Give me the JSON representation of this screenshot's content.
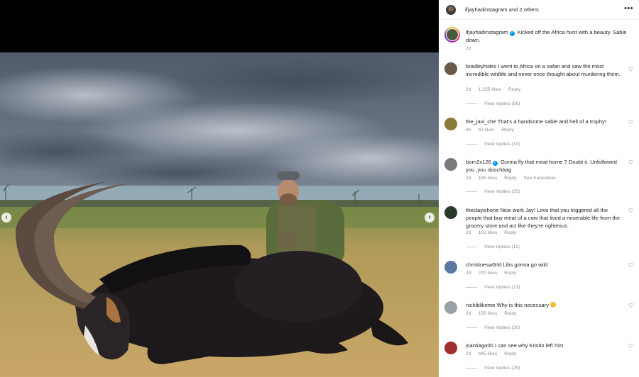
{
  "post": {
    "header_name": "ifjayhadinstagram and 2 others",
    "author": "ifjayhadinstagram",
    "caption": "Kicked off the Africa hunt with a beauty. Sable down.",
    "time": "2d"
  },
  "comments": [
    {
      "user": "bradleyhides",
      "text": "I went to Africa on a safari and saw the most incredible wildlife and never once thought about murdering them.",
      "time": "2d",
      "likes": "1,255 likes",
      "reply": "Reply",
      "replies": "View replies (56)",
      "avatar_color": "#6b5a4a"
    },
    {
      "user": "the_javi_che",
      "text": "That's a handsome sable and hell of a trophy!",
      "time": "8h",
      "likes": "43 likes",
      "reply": "Reply",
      "replies": "View replies (10)",
      "avatar_color": "#8a7a3a"
    },
    {
      "user": "born2x126",
      "text": "Gonna fly that meat home ? Doubt it. Unfollowed you ,you doochbag",
      "time": "2d",
      "likes": "155 likes",
      "reply": "Reply",
      "extra": "See translation",
      "replies": "View replies (25)",
      "avatar_color": "#7a7a7a"
    },
    {
      "user": "theclayishone",
      "text": "Nice work Jay! Love that you triggered all the people that buy meat of a cow that lived a miserable life from the grocery store and act like they're righteous.",
      "time": "2d",
      "likes": "103 likes",
      "reply": "Reply",
      "replies": "View replies (11)",
      "avatar_color": "#2a3a2a"
    },
    {
      "user": "christinesw0rld",
      "text": "Libs gonna go wild",
      "time": "2d",
      "likes": "270 likes",
      "reply": "Reply",
      "replies": "View replies (23)",
      "avatar_color": "#5a7aa0"
    },
    {
      "user": "nickiblikeme",
      "text": "Why is this necessary",
      "time": "2d",
      "likes": "159 likes",
      "reply": "Reply",
      "replies": "View replies (20)",
      "avatar_color": "#9aa0a8"
    },
    {
      "user": "jsantiago00",
      "text": "I can see why Kristin left him",
      "time": "2d",
      "likes": "445 likes",
      "reply": "Reply",
      "replies": "View replies (29)",
      "avatar_color": "#a03030"
    }
  ],
  "icons": {
    "more": "more-options-icon",
    "heart": "heart-icon",
    "prev": "chevron-left-icon",
    "next": "chevron-right-icon",
    "verified": "verified-badge-icon"
  },
  "colors": {
    "verified": "#0095f6",
    "meta_gray": "#8e8e8e"
  }
}
